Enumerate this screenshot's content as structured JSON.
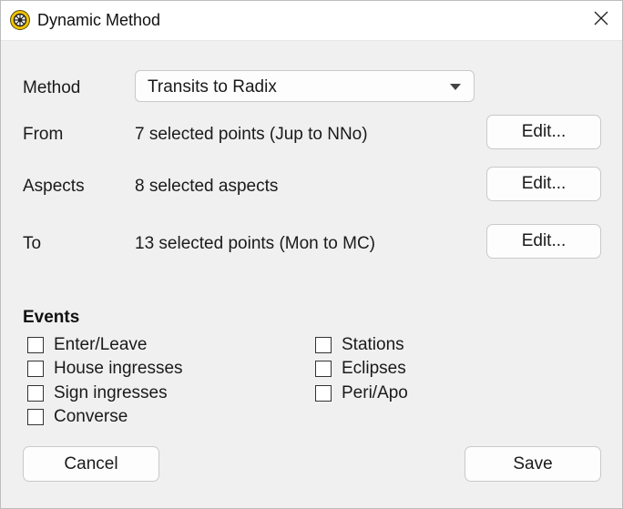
{
  "window": {
    "title": "Dynamic Method",
    "app_icon": "sun-wheel-icon",
    "close_icon": "close-icon"
  },
  "form": {
    "method_label": "Method",
    "method_value": "Transits to Radix",
    "from_label": "From",
    "from_value": "7 selected points (Jup to NNo)",
    "aspects_label": "Aspects",
    "aspects_value": "8 selected aspects",
    "to_label": "To",
    "to_value": "13 selected points (Mon to MC)",
    "edit_label": "Edit..."
  },
  "events": {
    "title": "Events",
    "left": [
      {
        "label": "Enter/Leave",
        "checked": false
      },
      {
        "label": "House ingresses",
        "checked": false
      },
      {
        "label": "Sign ingresses",
        "checked": false
      },
      {
        "label": "Converse",
        "checked": false
      }
    ],
    "right": [
      {
        "label": "Stations",
        "checked": false
      },
      {
        "label": "Eclipses",
        "checked": false
      },
      {
        "label": "Peri/Apo",
        "checked": false
      }
    ]
  },
  "footer": {
    "cancel_label": "Cancel",
    "save_label": "Save"
  },
  "colors": {
    "background": "#f0f0f0",
    "titlebar": "#ffffff",
    "button_bg": "#fdfdfd",
    "button_border": "#c9c9c9",
    "icon_yellow": "#f2c300"
  }
}
